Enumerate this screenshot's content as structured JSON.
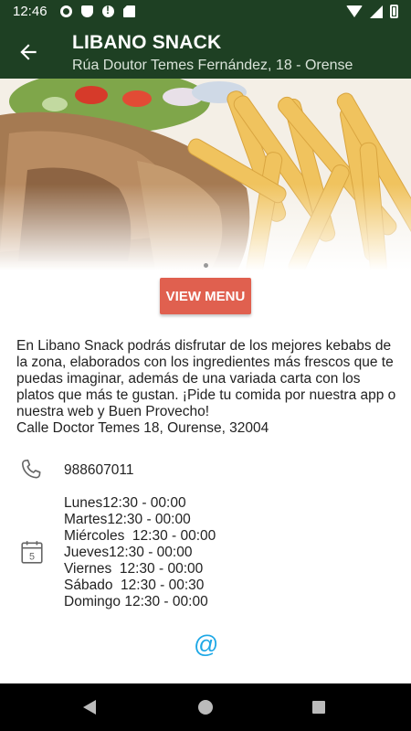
{
  "status_bar": {
    "time": "12:46",
    "icons": [
      "settings-icon",
      "shield-icon",
      "alert-icon",
      "sd-card-icon",
      "wifi-icon",
      "signal-icon",
      "battery-icon"
    ]
  },
  "app_bar": {
    "title": "LIBANO SNACK",
    "subtitle": "Rúa Doutor Temes Fernández, 18 - Orense",
    "background_color": "#1e4023"
  },
  "hero": {
    "description_icon": "kebab-and-fries-photo",
    "carousel_dots": 2,
    "active_dot": 0
  },
  "view_menu_button": {
    "label": "VIEW MENU",
    "color": "#e0604f"
  },
  "description": "En Libano Snack podrás disfrutar de los mejores kebabs de la zona, elaborados con los ingredientes más frescos que te puedas imaginar, además de una variada carta con los platos que más te gustan. ¡Pide tu comida por nuestra app o nuestra web y Buen Provecho!",
  "address": "Calle Doctor Temes 18, Ourense, 32004",
  "phone": "988607011",
  "hours": [
    "Lunes12:30 - 00:00",
    "Martes12:30 - 00:00",
    "Miércoles  12:30 - 00:00",
    "Jueves12:30 - 00:00",
    "Viernes  12:30 - 00:00",
    "Sábado  12:30 - 00:30",
    "Domingo 12:30 - 00:00"
  ],
  "email_symbol": "@",
  "email_color": "#1ea8e6"
}
